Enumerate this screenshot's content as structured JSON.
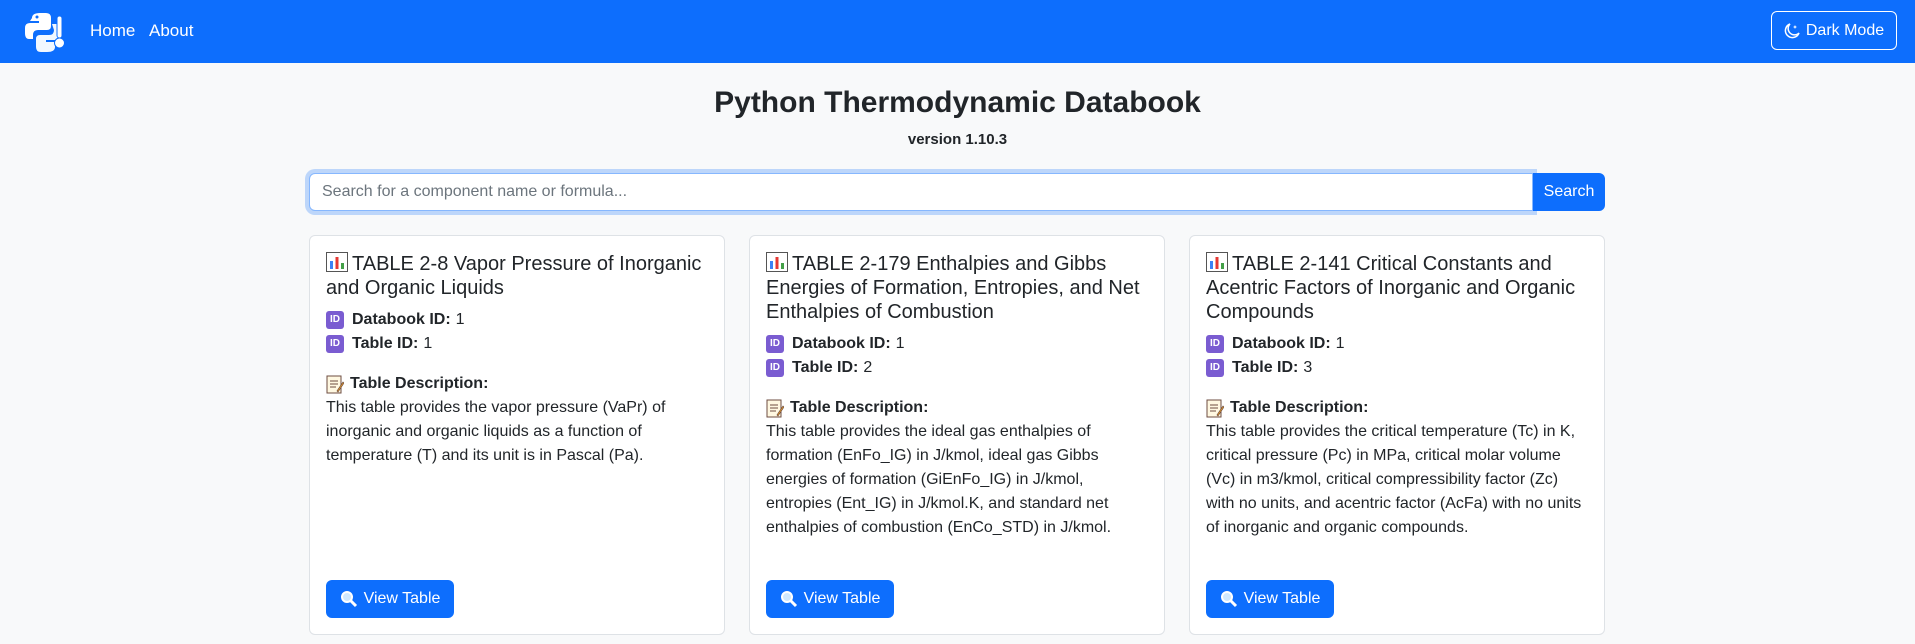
{
  "nav": {
    "home": "Home",
    "about": "About",
    "dark_mode": "Dark Mode"
  },
  "header": {
    "title": "Python Thermodynamic Databook",
    "version": "version 1.10.3"
  },
  "search": {
    "placeholder": "Search for a component name or formula...",
    "button": "Search"
  },
  "labels": {
    "databook_id": "Databook ID:",
    "table_id": "Table ID:",
    "description": "Table Description:",
    "view_table": "View Table"
  },
  "cards": [
    {
      "title": "TABLE 2-8 Vapor Pressure of Inorganic and Organic Liquids",
      "databook_id": "1",
      "table_id": "1",
      "description": "This table provides the vapor pressure (VaPr) of inorganic and organic liquids as a function of temperature (T) and its unit is in Pascal (Pa)."
    },
    {
      "title": "TABLE 2-179 Enthalpies and Gibbs Energies of Formation, Entropies, and Net Enthalpies of Combustion",
      "databook_id": "1",
      "table_id": "2",
      "description": "This table provides the ideal gas enthalpies of formation (EnFo_IG) in J/kmol, ideal gas Gibbs energies of formation (GiEnFo_IG) in J/kmol, entropies (Ent_IG) in J/kmol.K, and standard net enthalpies of combustion (EnCo_STD) in J/kmol."
    },
    {
      "title": "TABLE 2-141 Critical Constants and Acentric Factors of Inorganic and Organic Compounds",
      "databook_id": "1",
      "table_id": "3",
      "description": "This table provides the critical temperature (Tc) in K, critical pressure (Pc) in MPa, critical molar volume (Vc) in m3/kmol, critical compressibility factor (Zc) with no units, and acentric factor (AcFa) with no units of inorganic and organic compounds."
    }
  ],
  "colors": {
    "primary": "#0d6efd",
    "background": "#f8f9fa",
    "id_badge": "#7a5cd1"
  }
}
